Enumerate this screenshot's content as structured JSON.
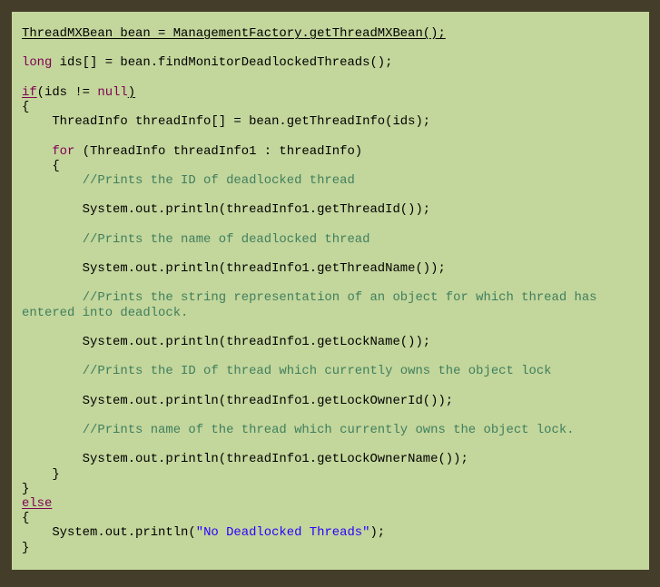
{
  "code": {
    "l1": "ThreadMXBean bean = ManagementFactory.getThreadMXBean();",
    "l3_kw": "long",
    "l3_rest": " ids[] = bean.findMonitorDeadlockedThreads();",
    "l5_kw": "if",
    "l5_mid": "(ids != ",
    "l5_null": "null",
    "l5_end": ")",
    "l6": "{",
    "l7": "    ThreadInfo threadInfo[] = bean.getThreadInfo(ids);",
    "l9_indent": "    ",
    "l9_kw": "for",
    "l9_rest": " (ThreadInfo threadInfo1 : threadInfo)",
    "l10": "    {",
    "l11_indent": "        ",
    "l11_comment": "//Prints the ID of deadlocked thread",
    "l13": "        System.out.println(threadInfo1.getThreadId());",
    "l15_indent": "        ",
    "l15_comment": "//Prints the name of deadlocked thread",
    "l17": "        System.out.println(threadInfo1.getThreadName());",
    "l19_indent": "        ",
    "l19_comment": "//Prints the string representation of an object for which thread has",
    "l20_comment": "entered into deadlock.",
    "l22": "        System.out.println(threadInfo1.getLockName());",
    "l24_indent": "        ",
    "l24_comment": "//Prints the ID of thread which currently owns the object lock",
    "l26": "        System.out.println(threadInfo1.getLockOwnerId());",
    "l28_indent": "        ",
    "l28_comment": "//Prints name of the thread which currently owns the object lock.",
    "l30": "        System.out.println(threadInfo1.getLockOwnerName());",
    "l31": "    }",
    "l32": "}",
    "l33_kw": "else",
    "l34": "{",
    "l35_pre": "    System.out.println(",
    "l35_str": "\"No Deadlocked Threads\"",
    "l35_end": ");",
    "l36": "}"
  },
  "colors": {
    "background": "#433d2a",
    "panel": "#c3d69b",
    "keyword": "#7f0055",
    "comment": "#3f7f5f",
    "string": "#2a00ff"
  }
}
